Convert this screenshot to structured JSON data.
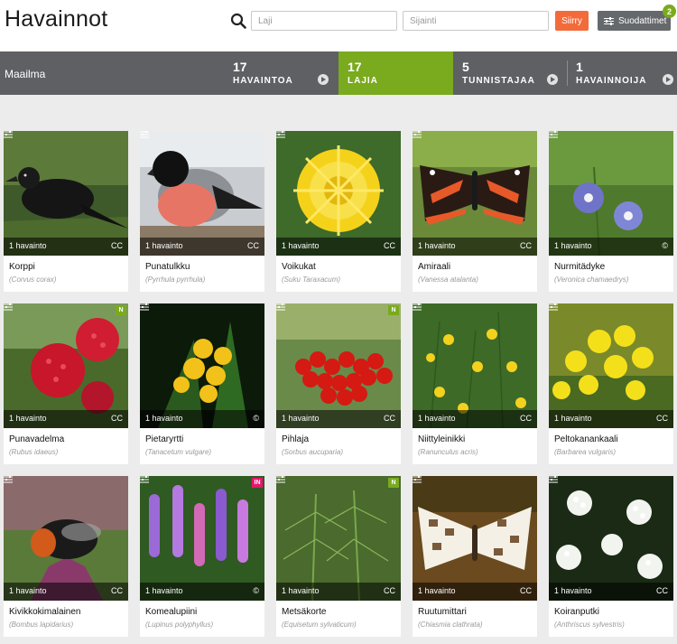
{
  "title": "Havainnot",
  "search": {
    "species_placeholder": "Laji",
    "location_placeholder": "Sijainti",
    "go_label": "Siirry"
  },
  "filters": {
    "label": "Suodattimet",
    "count": "2"
  },
  "stats": {
    "region": "Maailma",
    "items": [
      {
        "value": "17",
        "label": "HAVAINTOA"
      },
      {
        "value": "17",
        "label": "LAJIA"
      },
      {
        "value": "5",
        "label": "TUNNISTAJAA"
      },
      {
        "value": "1",
        "label": "HAVAINNOIJA"
      }
    ]
  },
  "colors": {
    "accent_green": "#7aaa1e",
    "go_orange": "#f36b3a",
    "invasive_pink": "#e8176f",
    "bar_gray": "#5e6063"
  },
  "species": [
    {
      "name": "Korppi",
      "scientific": "(Corvus corax)",
      "count": "1 havainto",
      "license": "CC",
      "badge": "",
      "image": "raven"
    },
    {
      "name": "Punatulkku",
      "scientific": "(Pyrrhula pyrrhula)",
      "count": "1 havainto",
      "license": "CC",
      "badge": "",
      "image": "bullfinch"
    },
    {
      "name": "Voikukat",
      "scientific": "(Suku Taraxacum)",
      "count": "1 havainto",
      "license": "CC",
      "badge": "",
      "image": "dandelion"
    },
    {
      "name": "Amiraali",
      "scientific": "(Vanessa atalanta)",
      "count": "1 havainto",
      "license": "CC",
      "badge": "",
      "image": "admiral"
    },
    {
      "name": "Nurmitädyke",
      "scientific": "(Veronica chamaedrys)",
      "count": "1 havainto",
      "license": "©",
      "badge": "",
      "image": "speedwell"
    },
    {
      "name": "Punavadelma",
      "scientific": "(Rubus idaeus)",
      "count": "1 havainto",
      "license": "CC",
      "badge": "N",
      "image": "raspberry"
    },
    {
      "name": "Pietaryrtti",
      "scientific": "(Tanacetum vulgare)",
      "count": "1 havainto",
      "license": "©",
      "badge": "",
      "image": "tansy"
    },
    {
      "name": "Pihlaja",
      "scientific": "(Sorbus aucuparia)",
      "count": "1 havainto",
      "license": "CC",
      "badge": "N",
      "image": "rowan"
    },
    {
      "name": "Niittyleinikki",
      "scientific": "(Ranunculus acris)",
      "count": "1 havainto",
      "license": "CC",
      "badge": "",
      "image": "buttercup"
    },
    {
      "name": "Peltokanankaali",
      "scientific": "(Barbarea vulgaris)",
      "count": "1 havainto",
      "license": "CC",
      "badge": "",
      "image": "rocket"
    },
    {
      "name": "Kivikkokimalainen",
      "scientific": "(Bombus lapidarius)",
      "count": "1 havainto",
      "license": "CC",
      "badge": "",
      "image": "bumblebee"
    },
    {
      "name": "Komealupiini",
      "scientific": "(Lupinus polyphyllus)",
      "count": "1 havainto",
      "license": "©",
      "badge": "IN",
      "image": "lupine"
    },
    {
      "name": "Metsäkorte",
      "scientific": "(Equisetum sylvaticum)",
      "count": "1 havainto",
      "license": "CC",
      "badge": "N",
      "image": "horsetail"
    },
    {
      "name": "Ruutumittari",
      "scientific": "(Chiasmia clathrata)",
      "count": "1 havainto",
      "license": "CC",
      "badge": "",
      "image": "moth"
    },
    {
      "name": "Koiranputki",
      "scientific": "(Anthriscus sylvestris)",
      "count": "1 havainto",
      "license": "CC",
      "badge": "",
      "image": "cowparsley"
    }
  ]
}
